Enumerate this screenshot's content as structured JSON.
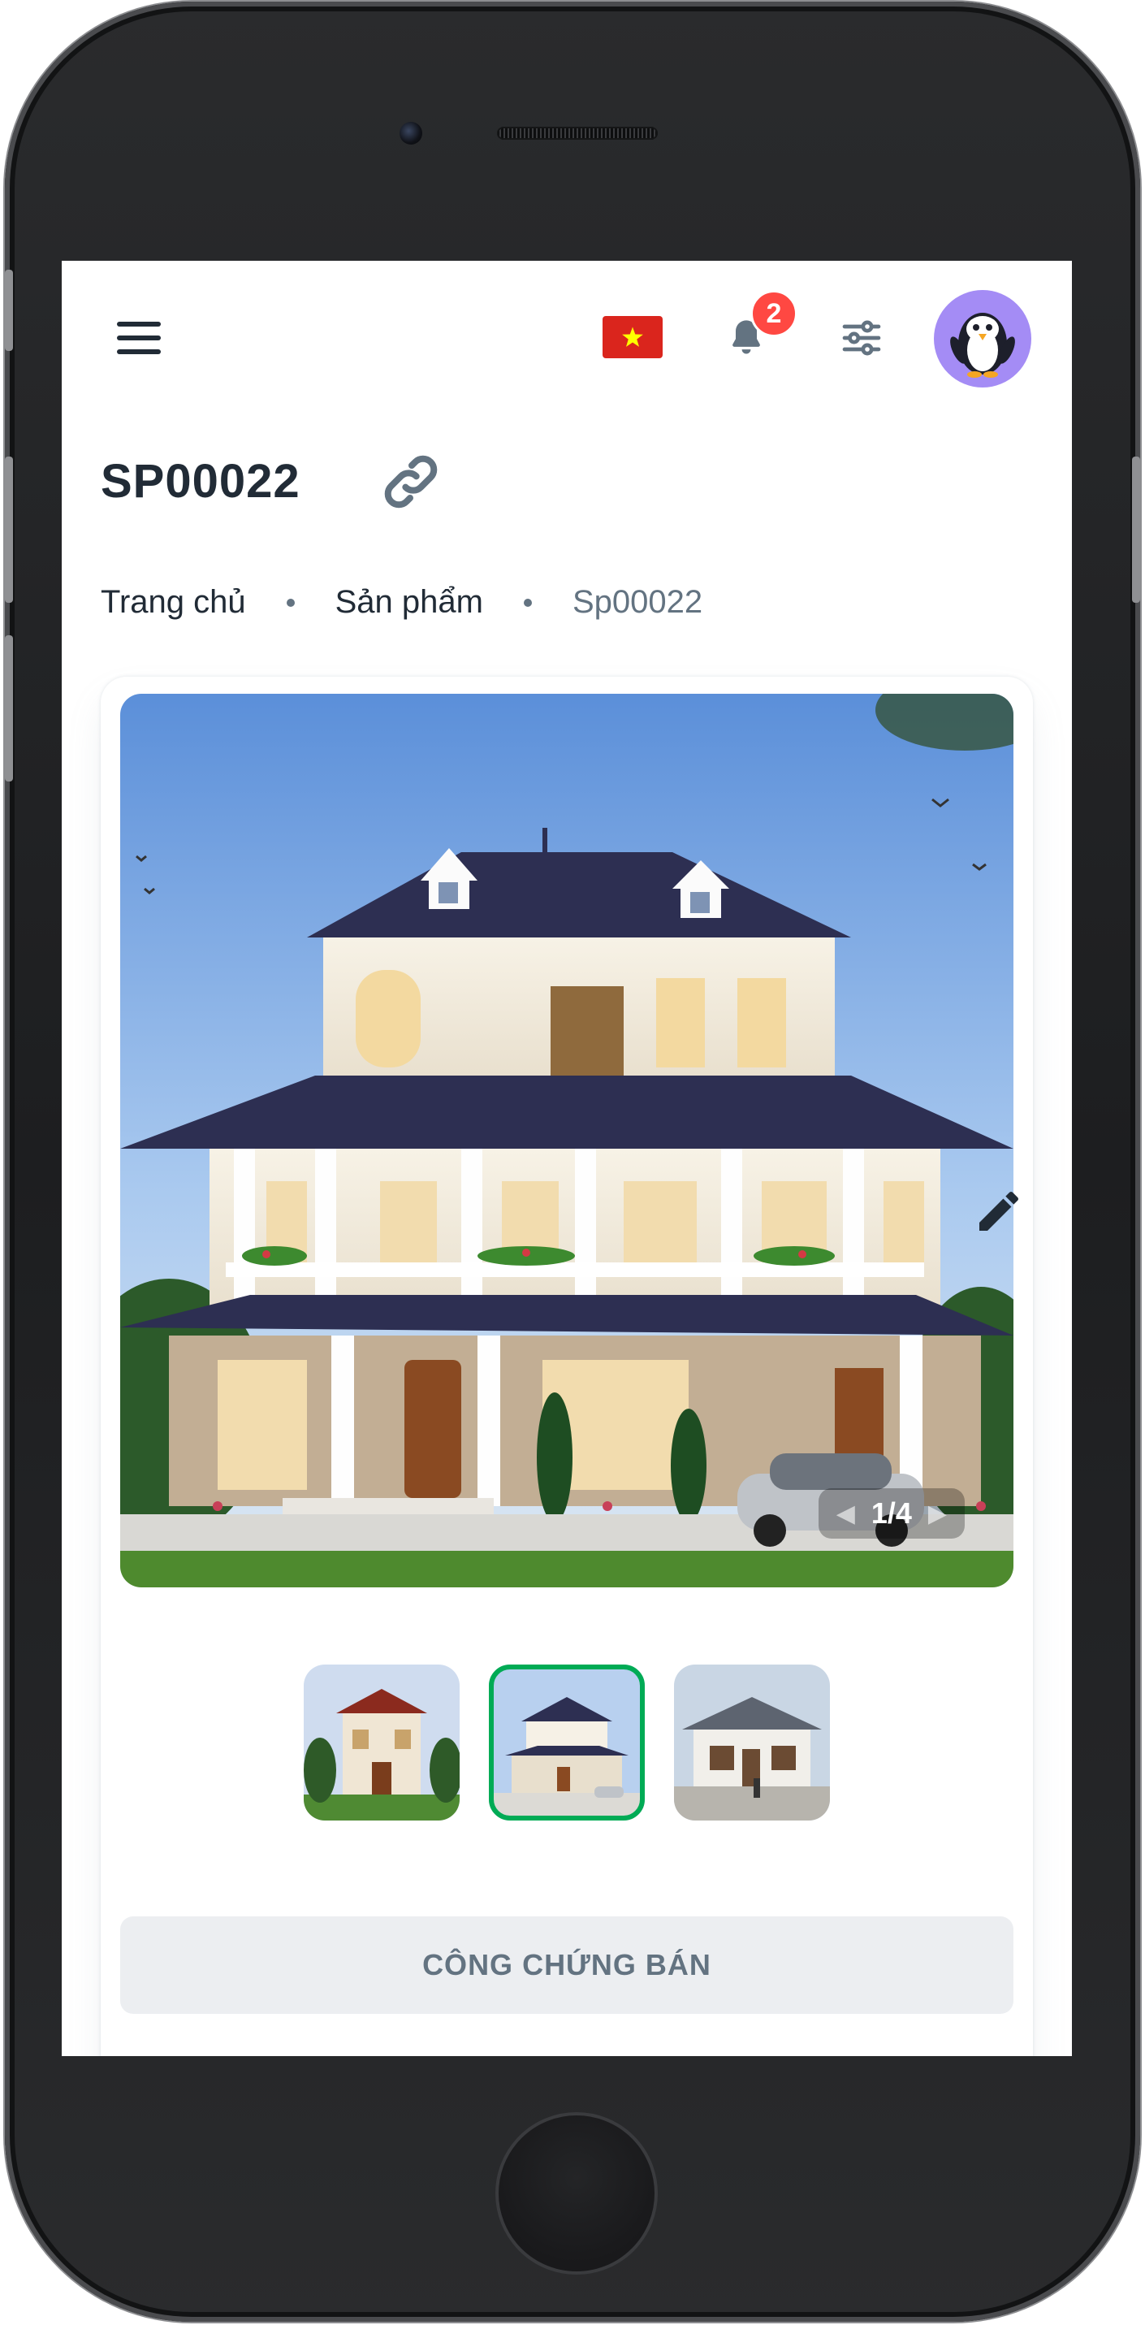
{
  "header": {
    "language_flag": "vn-flag",
    "notifications_count": "2",
    "icons": [
      "menu-icon",
      "bell-icon",
      "sliders-icon",
      "penguin-avatar"
    ]
  },
  "page": {
    "title": "SP00022",
    "breadcrumb": [
      "Trang chủ",
      "Sản phẩm",
      "Sp00022"
    ]
  },
  "gallery": {
    "counter": "1/4",
    "thumbnails": [
      "villa-red-roof",
      "villa-white-navy-roof",
      "house-grey-roof"
    ],
    "active_thumbnail": 1
  },
  "actions": {
    "notarize_label": "CÔNG CHỨNG BÁN"
  },
  "colors": {
    "primary_text": "#212b36",
    "secondary_text": "#637381",
    "accent_green": "#00ab55",
    "badge_red": "#ff4842",
    "avatar_bg": "#a48cf5",
    "button_bg": "#eceef1"
  }
}
